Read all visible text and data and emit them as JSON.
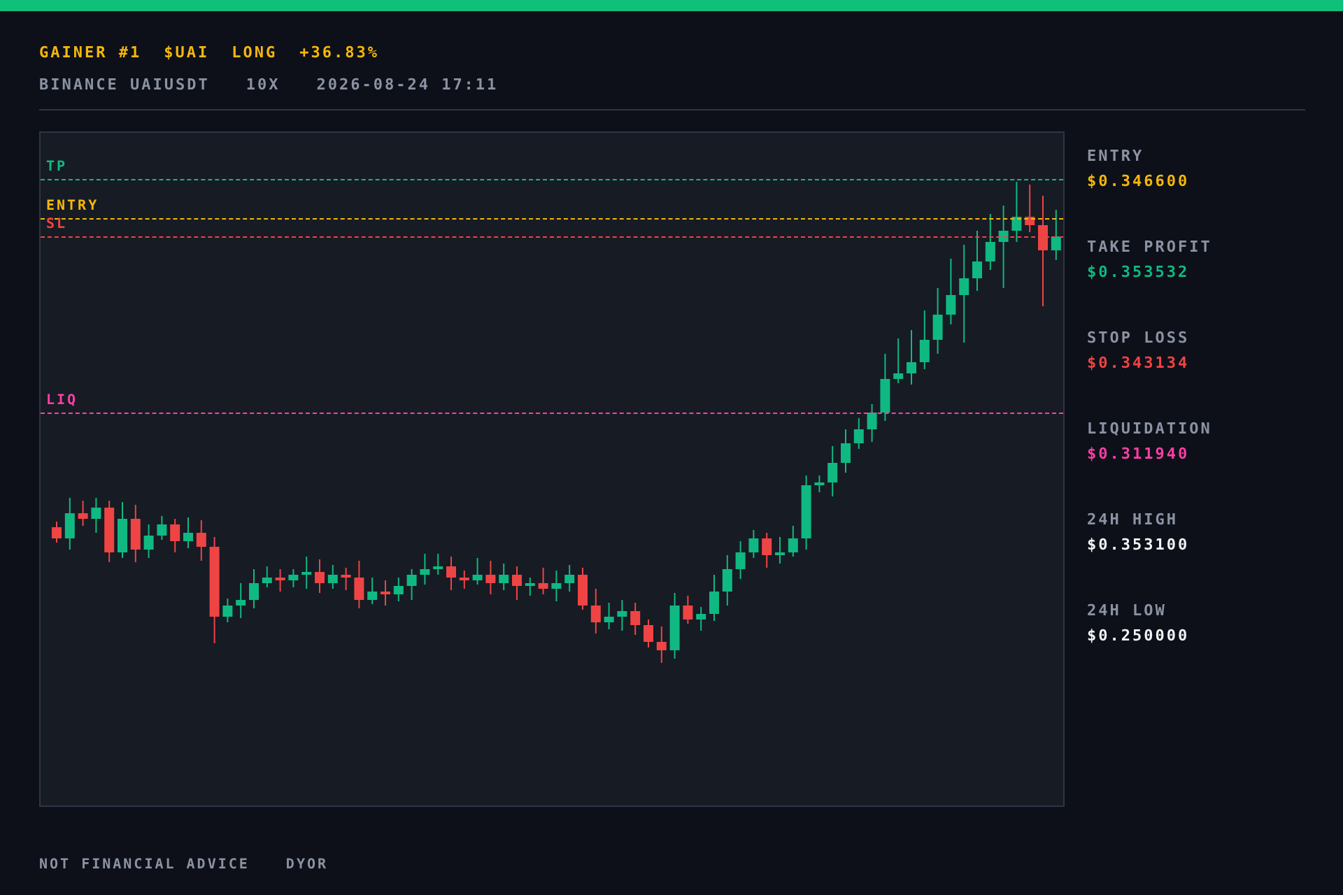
{
  "header": {
    "headline": [
      "GAINER #1",
      "$UAI",
      "LONG",
      "+36.83%"
    ],
    "subline": [
      "BINANCE UAIUSDT",
      "10X",
      "2026-08-24 17:11"
    ]
  },
  "chart": {
    "levels": [
      {
        "label": "TP",
        "color": "#10b981"
      },
      {
        "label": "ENTRY",
        "color": "#f5b70a"
      },
      {
        "label": "SL",
        "color": "#f04444"
      },
      {
        "label": "LIQ",
        "color": "#ff3fa4"
      }
    ]
  },
  "stats": [
    {
      "label": "ENTRY",
      "value": "$0.346600",
      "color": "#f5b70a"
    },
    {
      "label": "TAKE PROFIT",
      "value": "$0.353532",
      "color": "#10b981"
    },
    {
      "label": "STOP LOSS",
      "value": "$0.343134",
      "color": "#f04444"
    },
    {
      "label": "LIQUIDATION",
      "value": "$0.311940",
      "color": "#ff3fa4"
    },
    {
      "label": "24H HIGH",
      "value": "$0.353100",
      "color": "#f3f4f6"
    },
    {
      "label": "24H LOW",
      "value": "$0.250000",
      "color": "#f3f4f6"
    }
  ],
  "footer": [
    "NOT FINANCIAL ADVICE",
    "DYOR"
  ]
}
